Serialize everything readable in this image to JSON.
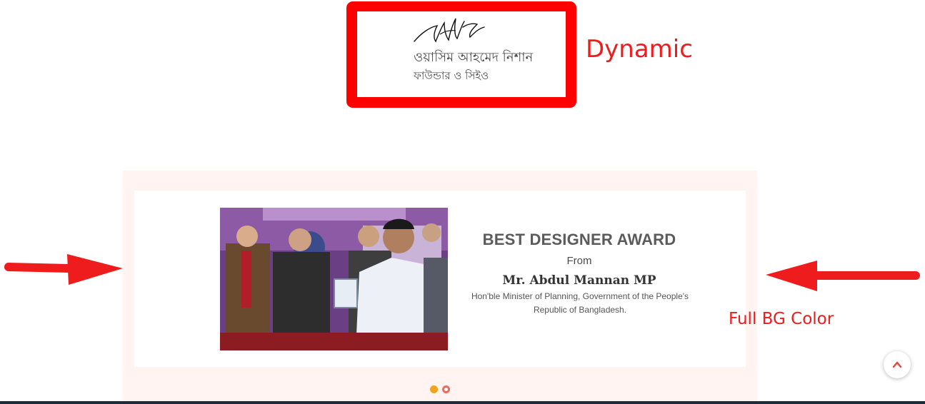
{
  "signature_card": {
    "name": "ওয়াসিম আহমেদ নিশান",
    "title": "ফাউন্ডার ও সিইও"
  },
  "annotations": {
    "dynamic": "Dynamic",
    "full_bg": "Full BG Color"
  },
  "award": {
    "title": "BEST DESIGNER AWARD",
    "from_label": "From",
    "person": "Mr. Abdul Mannan MP",
    "description": "Hon'ble Minister of Planning, Government of the People's Republic of Bangladesh."
  },
  "carousel": {
    "slide_count": 2,
    "active_index": 0
  },
  "icons": {
    "scroll_top": "chevron-up-icon",
    "arrows": "red-arrow-icon"
  },
  "colors": {
    "annotation_red": "#ee1c1c",
    "section_bg": "#fff4f2",
    "dot_active": "#f3a31f",
    "dot_inactive": "#f06a5f"
  }
}
